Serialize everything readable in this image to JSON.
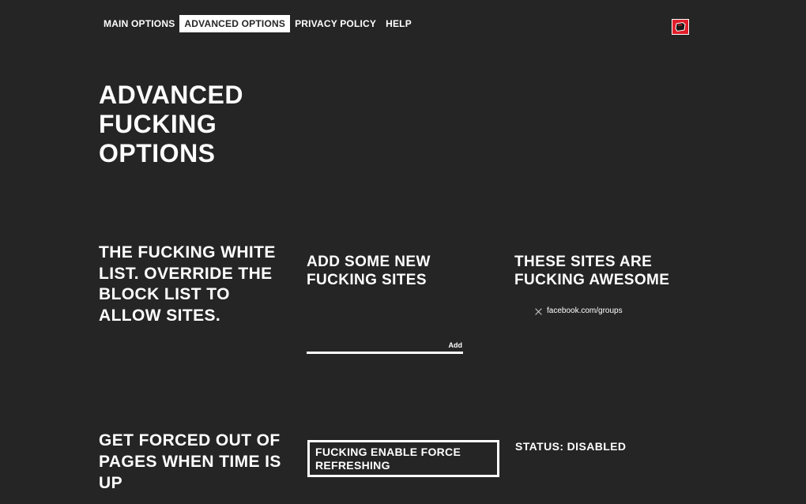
{
  "nav": {
    "items": [
      {
        "label": "MAIN OPTIONS",
        "active": false
      },
      {
        "label": "ADVANCED OPTIONS",
        "active": true
      },
      {
        "label": "PRIVACY POLICY",
        "active": false
      },
      {
        "label": "HELP",
        "active": false
      }
    ]
  },
  "logo": {
    "icon": "brand-logo-icon",
    "color": "#e01e2a"
  },
  "page": {
    "title": "ADVANCED FUCKING OPTIONS"
  },
  "whitelist": {
    "description": "THE FUCKING WHITE LIST. OVERRIDE THE BLOCK LIST TO ALLOW SITES.",
    "add_heading": "ADD SOME NEW FUCKING SITES",
    "input_value": "",
    "add_label": "Add",
    "list_heading": "THESE SITES ARE FUCKING AWESOME",
    "sites": [
      "facebook.com/groups"
    ]
  },
  "force_refresh": {
    "heading": "GET FORCED OUT OF PAGES WHEN TIME IS UP",
    "button_label": "FUCKING ENABLE FORCE REFRESHING",
    "status": "STATUS: DISABLED"
  },
  "colors": {
    "background": "#252525",
    "accent": "#e01e2a",
    "text": "#ffffff"
  }
}
